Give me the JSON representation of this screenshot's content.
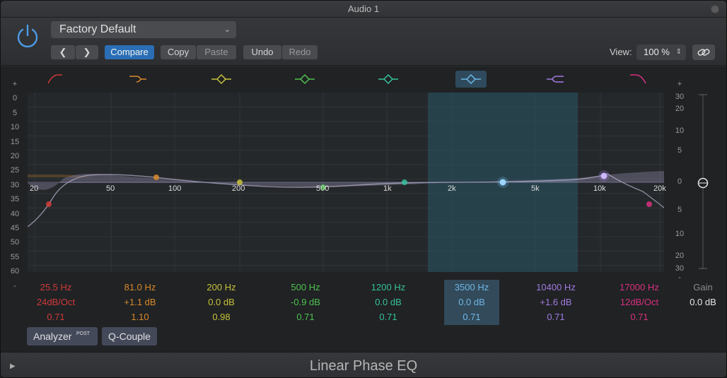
{
  "window": {
    "title": "Audio 1"
  },
  "header": {
    "preset": "Factory Default",
    "compare_label": "Compare",
    "copy_label": "Copy",
    "paste_label": "Paste",
    "undo_label": "Undo",
    "redo_label": "Redo",
    "view_label": "View:",
    "view_value": "100 %"
  },
  "db_scale": [
    "+",
    "0",
    "5",
    "10",
    "15",
    "20",
    "25",
    "30",
    "35",
    "40",
    "45",
    "50",
    "55",
    "60",
    "-"
  ],
  "gain_scale": [
    "+",
    "30",
    "20",
    "10",
    "5",
    "0",
    "5",
    "10",
    "20",
    "30",
    "-"
  ],
  "freq_labels": [
    "20",
    "50",
    "100",
    "200",
    "500",
    "1k",
    "2k",
    "5k",
    "10k",
    "20k"
  ],
  "bands": [
    {
      "freq": "25.5 Hz",
      "gain": "24dB/Oct",
      "q": "0.71",
      "color": "#d23a3a"
    },
    {
      "freq": "81.0 Hz",
      "gain": "+1.1 dB",
      "q": "1.10",
      "color": "#d98a2b"
    },
    {
      "freq": "200 Hz",
      "gain": "0.0 dB",
      "q": "0.98",
      "color": "#c8c23a"
    },
    {
      "freq": "500 Hz",
      "gain": "-0.9 dB",
      "q": "0.71",
      "color": "#4fc04f"
    },
    {
      "freq": "1200 Hz",
      "gain": "0.0 dB",
      "q": "0.71",
      "color": "#35c29a"
    },
    {
      "freq": "3500 Hz",
      "gain": "0.0 dB",
      "q": "0.71",
      "color": "#6fb7e6"
    },
    {
      "freq": "10400 Hz",
      "gain": "+1.6 dB",
      "q": "0.71",
      "color": "#a27be0"
    },
    {
      "freq": "17000 Hz",
      "gain": "12dB/Oct",
      "q": "0.71",
      "color": "#d9307f"
    }
  ],
  "gain": {
    "label": "Gain",
    "value": "0.0 dB"
  },
  "analyzer": {
    "label": "Analyzer",
    "post": "POST"
  },
  "qcouple": {
    "label": "Q-Couple"
  },
  "plugin_name": "Linear Phase EQ",
  "selected_band": 6
}
